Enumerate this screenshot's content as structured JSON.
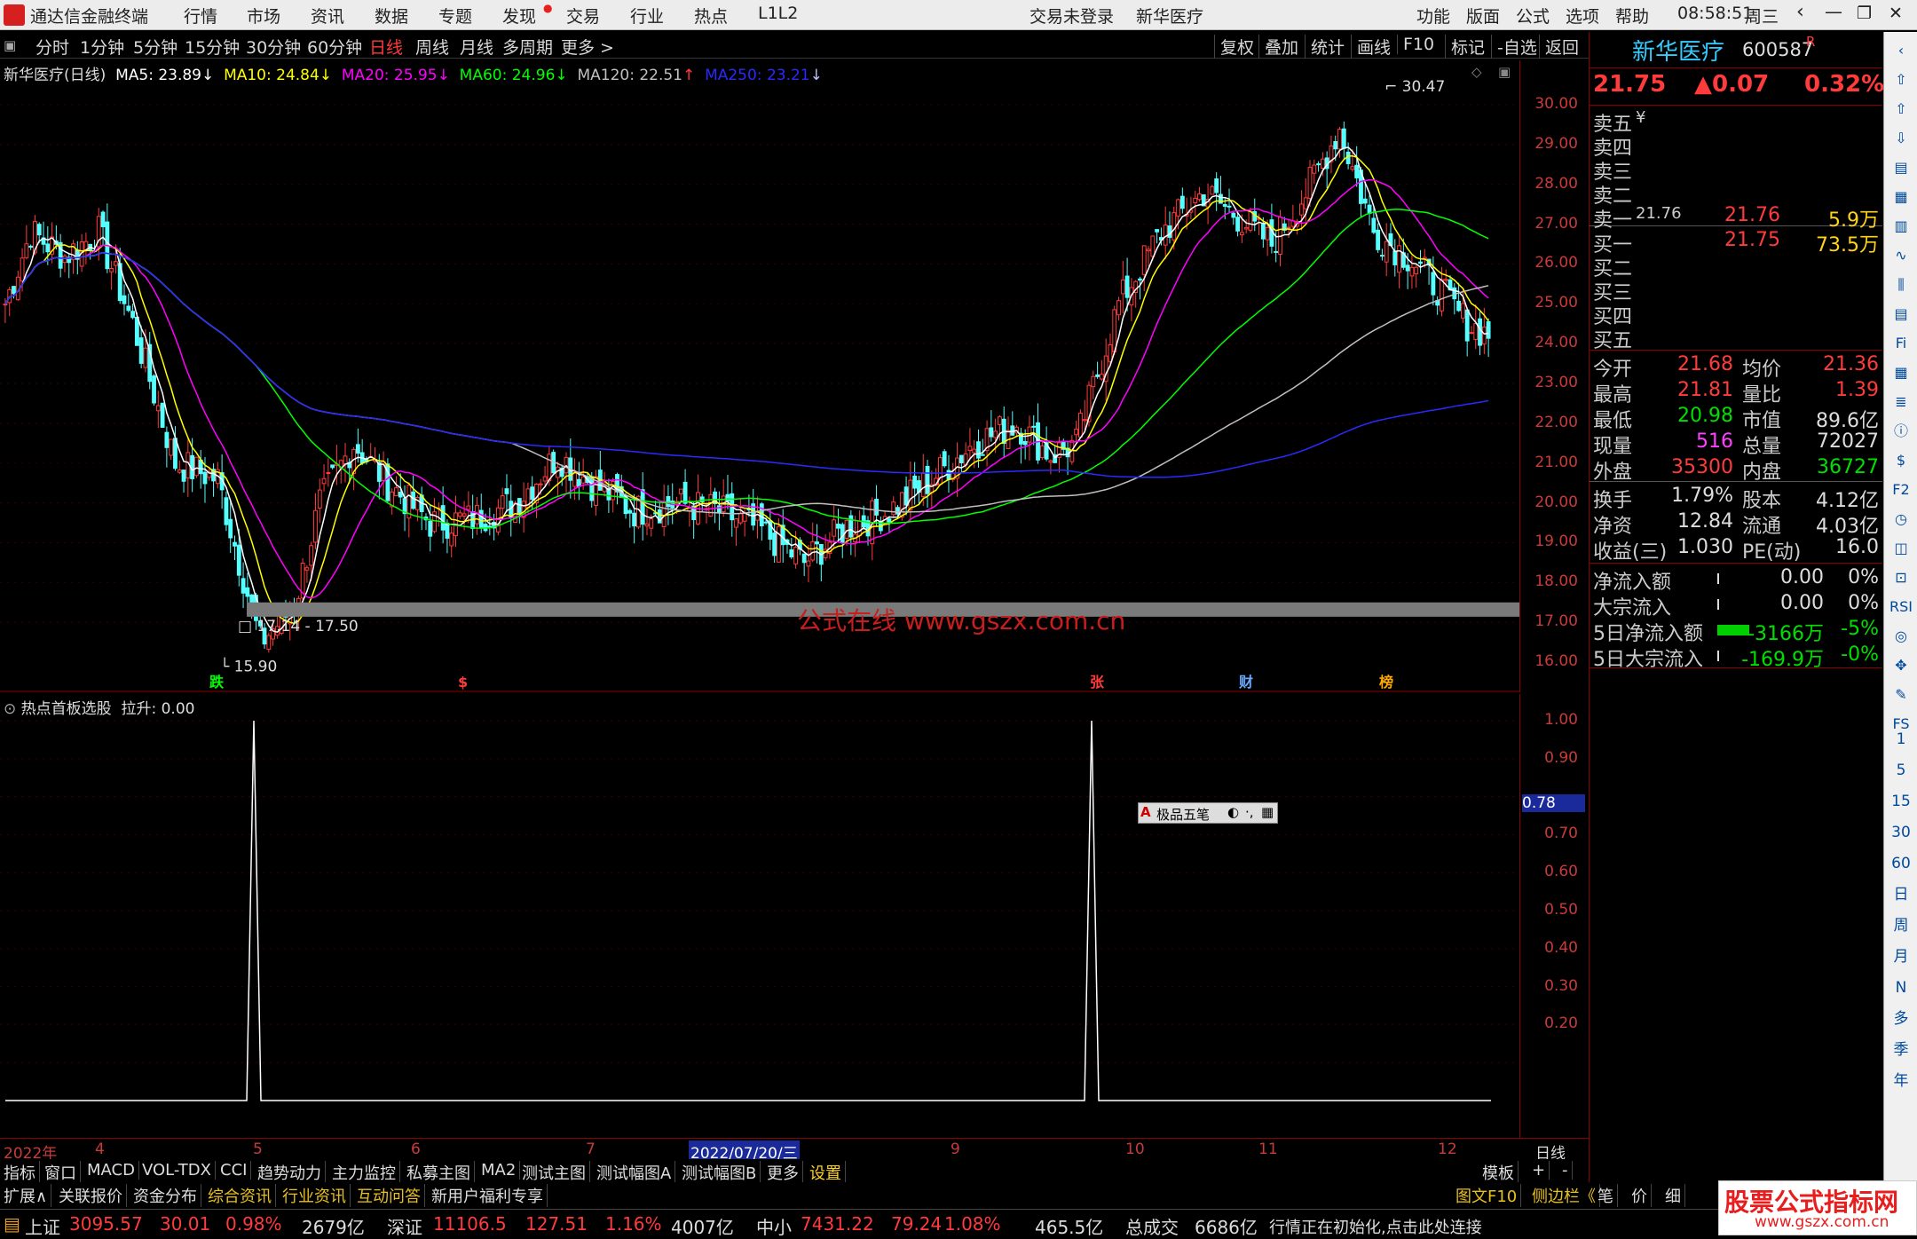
{
  "titlebar": {
    "app": "通达信金融终端",
    "menus": [
      "行情",
      "市场",
      "资讯",
      "数据",
      "专题",
      "发现",
      "交易",
      "行业",
      "热点",
      "L1L2"
    ],
    "status_center": "交易未登录",
    "stock_center": "新华医疗",
    "right_menus": [
      "功能",
      "版面",
      "公式",
      "选项",
      "帮助"
    ],
    "time": "08:58:51",
    "weekday": "周三"
  },
  "periods": [
    "分时",
    "1分钟",
    "5分钟",
    "15分钟",
    "30分钟",
    "60分钟",
    "日线",
    "周线",
    "月线",
    "多周期",
    "更多 >"
  ],
  "active_period": "日线",
  "toolbar_right": [
    "复权",
    "叠加",
    "统计",
    "画线",
    "F10",
    "标记",
    "-自选",
    "返回"
  ],
  "ma_legend": {
    "name": "新华医疗(日线)",
    "ma5": "MA5: 23.89",
    "ma10": "MA10: 24.84",
    "ma20": "MA20: 25.95",
    "ma60": "MA60: 24.96",
    "ma120": "MA120: 22.51",
    "ma250": "MA250: 23.21"
  },
  "colors": {
    "ma5": "#ffffff",
    "ma10": "#ffff00",
    "ma20": "#ff00ff",
    "ma60": "#00ff00",
    "ma120": "#c0c0c0",
    "ma250": "#0000ff",
    "up": "#ff3b3b",
    "down": "#54ffff"
  },
  "main_axis": [
    "30.00",
    "29.00",
    "28.00",
    "27.00",
    "26.00",
    "25.00",
    "24.00",
    "23.00",
    "22.00",
    "21.00",
    "20.00",
    "19.00",
    "18.00",
    "17.00",
    "16.00"
  ],
  "annotations": {
    "high": "30.47",
    "low": "15.90",
    "band": "17.14 - 17.50",
    "watermark": "公式在线 www.gszx.com.cn"
  },
  "markers": [
    "跌",
    "$",
    "张",
    "财",
    "榜"
  ],
  "indicator": {
    "name": "热点首板选股",
    "value": "拉升: 0.00",
    "axis": [
      "1.00",
      "0.90",
      "0.78",
      "0.70",
      "0.60",
      "0.50",
      "0.40",
      "0.30",
      "0.20"
    ],
    "highlight": "0.78"
  },
  "floatbar": {
    "label": "极品五笔"
  },
  "xaxis": {
    "labels": [
      "2022年",
      "4",
      "5",
      "6",
      "7",
      "2022/07/20/三",
      "9",
      "10",
      "11",
      "12"
    ],
    "right": "日线"
  },
  "bottom_tabs": [
    "指标",
    "窗口",
    "MACD",
    "VOL-TDX",
    "CCI",
    "趋势动力",
    "主力监控",
    "私募主图",
    "MA2",
    "测试主图",
    "测试幅图A",
    "测试幅图B",
    "更多",
    "设置"
  ],
  "bottom_tabs_right": [
    "模板",
    "+",
    "-"
  ],
  "bottom_tabs2": [
    "扩展∧",
    "关联报价",
    "资金分布",
    "综合资讯",
    "行业资讯",
    "互动问答",
    "新用户福利专享"
  ],
  "bottom_tabs2_right": [
    "图文F10",
    "侧边栏《",
    "笔",
    "价",
    "细"
  ],
  "status": {
    "sh_name": "上证",
    "sh_val": "3095.57",
    "sh_chg": "30.01",
    "sh_pct": "0.98%",
    "sh_amt": "2679亿",
    "sz_name": "深证",
    "sz_val": "11106.5",
    "sz_chg": "127.51",
    "sz_pct": "1.16%",
    "sz_amt": "4007亿",
    "zx_name": "中小",
    "zx_val": "7431.22",
    "zx_chg": "79.24",
    "zx_pct": "1.08%",
    "zx_amt": "465.5亿",
    "total_lab": "总成交",
    "total_val": "6686亿",
    "msg": "行情正在初始化,点击此处连接"
  },
  "quote": {
    "name": "新华医疗",
    "code": "600587",
    "flag": "R",
    "price": "21.75",
    "change": "▲0.07",
    "pct": "0.32%",
    "asks": [
      [
        "卖五",
        "¥",
        ""
      ],
      [
        "卖四",
        "",
        ""
      ],
      [
        "卖三",
        "",
        ""
      ],
      [
        "卖二",
        "",
        ""
      ],
      [
        "卖一",
        "21.76",
        "5.9万"
      ]
    ],
    "bids": [
      [
        "买一",
        "21.75",
        "73.5万"
      ],
      [
        "买二",
        "",
        ""
      ],
      [
        "买三",
        "",
        ""
      ],
      [
        "买四",
        "",
        ""
      ],
      [
        "买五",
        "",
        ""
      ]
    ],
    "stats": [
      [
        "今开",
        "21.68",
        "均价",
        "21.36"
      ],
      [
        "最高",
        "21.81",
        "量比",
        "1.39"
      ],
      [
        "最低",
        "20.98",
        "市值",
        "89.6亿"
      ],
      [
        "现量",
        "516",
        "总量",
        "72027"
      ],
      [
        "外盘",
        "35300",
        "内盘",
        "36727"
      ]
    ],
    "fund": [
      [
        "换手",
        "1.79%",
        "股本",
        "4.12亿"
      ],
      [
        "净资",
        "12.84",
        "流通",
        "4.03亿"
      ],
      [
        "收益(三)",
        "1.030",
        "PE(动)",
        "16.0"
      ]
    ],
    "flow": [
      [
        "净流入额",
        "0.00",
        "0%"
      ],
      [
        "大宗流入",
        "0.00",
        "0%"
      ],
      [
        "5日净流入额",
        "-3166万",
        "-5%"
      ],
      [
        "5日大宗流入",
        "-169.9万",
        "-0%"
      ]
    ]
  },
  "sidebar_labels": [
    "1",
    "5",
    "15",
    "30",
    "60",
    "日",
    "周",
    "月",
    "N",
    "多",
    "季",
    "年"
  ],
  "brand": {
    "text": "股票公式指标网",
    "url": "www.gszx.com.cn"
  }
}
